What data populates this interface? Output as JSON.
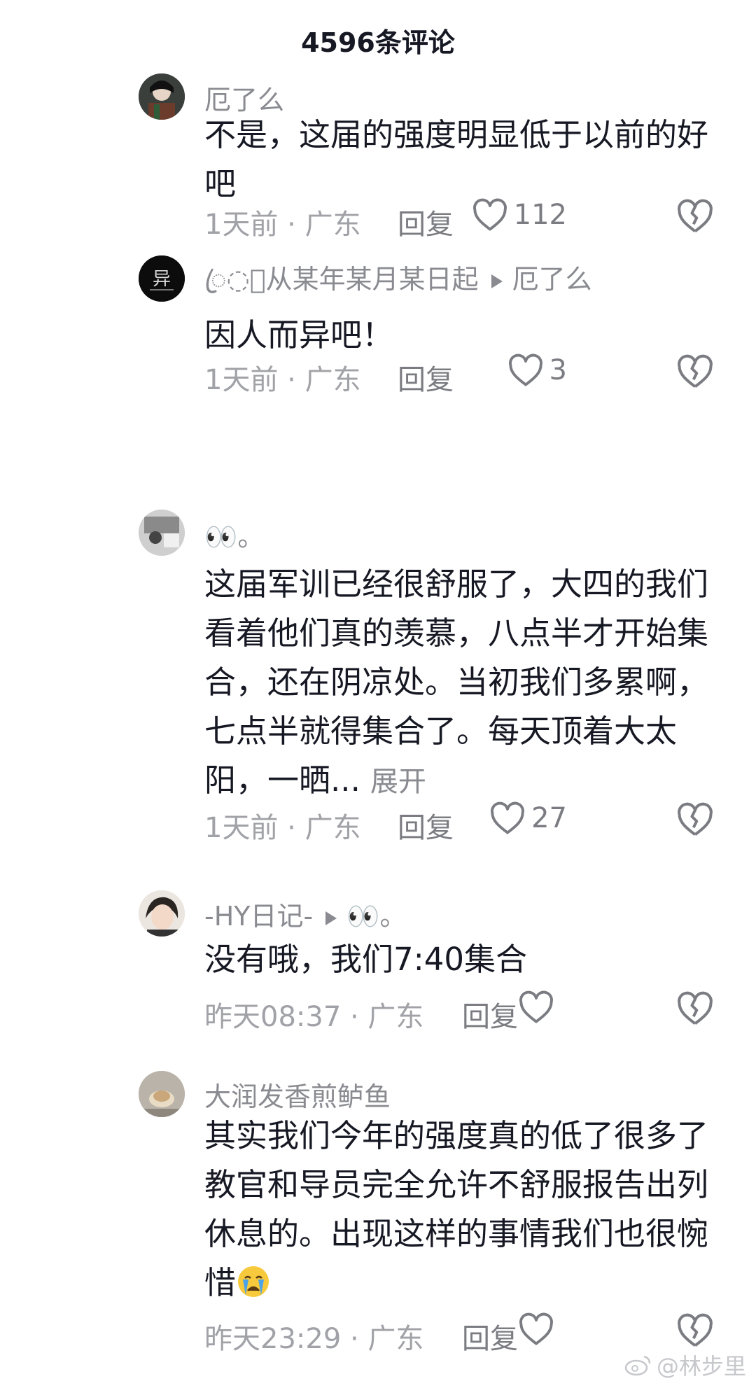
{
  "header": {
    "title": "4596条评论"
  },
  "comments": [
    {
      "username": "厄了么",
      "reply_to": "",
      "text": "不是，这届的强度明显低于以前的好吧",
      "expand": "",
      "time_location": "1天前 · 广东",
      "reply_label": "回复",
      "likes": "112"
    },
    {
      "username": "ꦿ◌゚从某年某月某日起",
      "reply_to": "厄了么",
      "text": "因人而异吧！",
      "expand": "",
      "time_location": "1天前 · 广东",
      "reply_label": "回复",
      "likes": "3"
    },
    {
      "username": "👀。",
      "reply_to": "",
      "text": "这届军训已经很舒服了，大四的我们看着他们真的羡慕，八点半才开始集合，还在阴凉处。当初我们多累啊，七点半就得集合了。每天顶着大太阳，一晒...",
      "expand": "展开",
      "time_location": "1天前 · 广东",
      "reply_label": "回复",
      "likes": "27"
    },
    {
      "username": "-HY日记-",
      "reply_to": "👀。",
      "text": "没有哦，我们7:40集合",
      "expand": "",
      "time_location": "昨天08:37 · 广东",
      "reply_label": "回复",
      "likes": ""
    },
    {
      "username": "大润发香煎鲈鱼",
      "reply_to": "",
      "text": "其实我们今年的强度真的低了很多了 教官和导员完全允许不舒服报告出列休息的。出现这样的事情我们也很惋惜",
      "expand": "",
      "time_location": "昨天23:29 · 广东",
      "reply_label": "回复",
      "likes": ""
    }
  ],
  "watermark": {
    "text": "@林步里"
  },
  "icons": {
    "like": "heart-outline-icon",
    "dislike": "broken-heart-icon",
    "weibo": "weibo-logo-icon"
  }
}
